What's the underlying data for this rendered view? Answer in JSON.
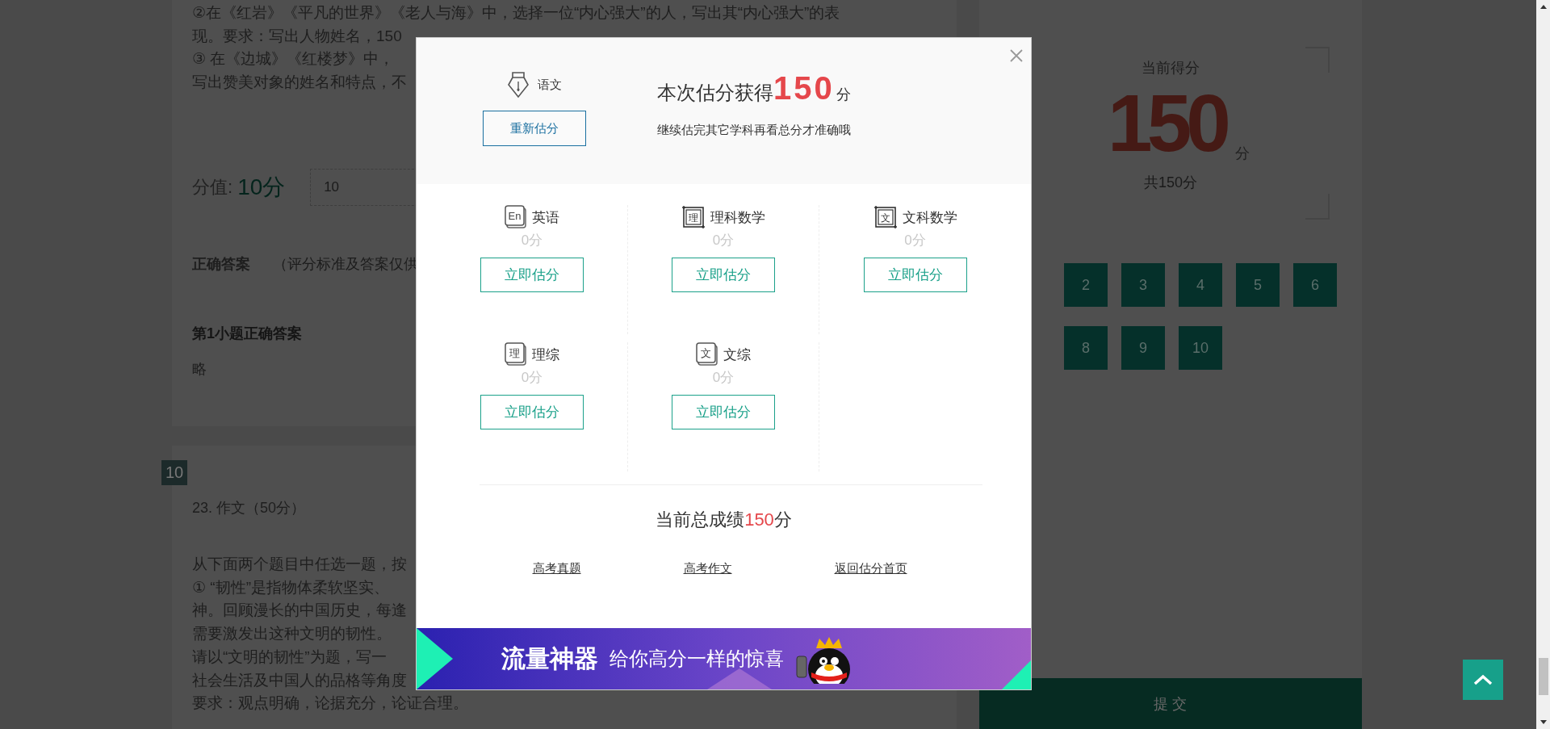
{
  "question_9": {
    "lines": [
      "②在《红岩》《平凡的世界》《老人与海》中，选择一位“内心强大”的人，写出其“内心强大”的表",
      "现。要求：写出人物姓名，150",
      "③ 在《边城》《红楼梦》中，",
      "写出赞美对象的姓名和特点，不"
    ],
    "score_label": "分值:",
    "score_value": "10分",
    "score_input": "10",
    "answer_title": "正确答案",
    "answer_note": "（评分标准及答案仅供",
    "sub_answer_title": "第1小题正确答案",
    "sub_answer": "略"
  },
  "question_10": {
    "badge": "10",
    "title": "23. 作文（50分）",
    "lines": [
      "从下面两个题目中任选一题，按",
      "① “韧性”是指物体柔软坚实、",
      "神。回顾漫长的中国历史，每逢",
      "需要激发出这种文明的韧性。",
      "请以“文明的韧性”为题，写一",
      "社会生活及中国人的品格等角度",
      "要求：观点明确，论据充分，论证合理。"
    ]
  },
  "score_panel": {
    "title": "当前得分",
    "score": "150",
    "unit": "分",
    "total": "共150分",
    "questions": [
      {
        "label": "2"
      },
      {
        "label": "3"
      },
      {
        "label": "4"
      },
      {
        "label": "5"
      },
      {
        "label": "6"
      },
      {
        "label": "8"
      },
      {
        "label": "9"
      },
      {
        "label": "10"
      }
    ],
    "submit": "提 交"
  },
  "dialog": {
    "subject": {
      "name": "语文",
      "button": "重新估分"
    },
    "result_prefix": "本次估分获得",
    "result_score": "150",
    "result_unit": "分",
    "hint": "继续估完其它学科再看总分才准确哦",
    "subjects": [
      {
        "kind": "book",
        "icon_text": "En",
        "name": "英语",
        "score": "0分",
        "button": "立即估分"
      },
      {
        "kind": "frame",
        "icon_text": "理",
        "name": "理科数学",
        "score": "0分",
        "button": "立即估分"
      },
      {
        "kind": "frame",
        "icon_text": "文",
        "name": "文科数学",
        "score": "0分",
        "button": "立即估分"
      },
      {
        "kind": "book",
        "icon_text": "理",
        "name": "理综",
        "score": "0分",
        "button": "立即估分"
      },
      {
        "kind": "book",
        "icon_text": "文",
        "name": "文综",
        "score": "0分",
        "button": "立即估分"
      }
    ],
    "total_prefix": "当前总成绩",
    "total_score": "150",
    "total_unit": "分",
    "links": [
      "高考真题",
      "高考作文",
      "返回估分首页"
    ],
    "banner": {
      "headline": "流量神器",
      "tagline": "给你高分一样的惊喜"
    }
  }
}
